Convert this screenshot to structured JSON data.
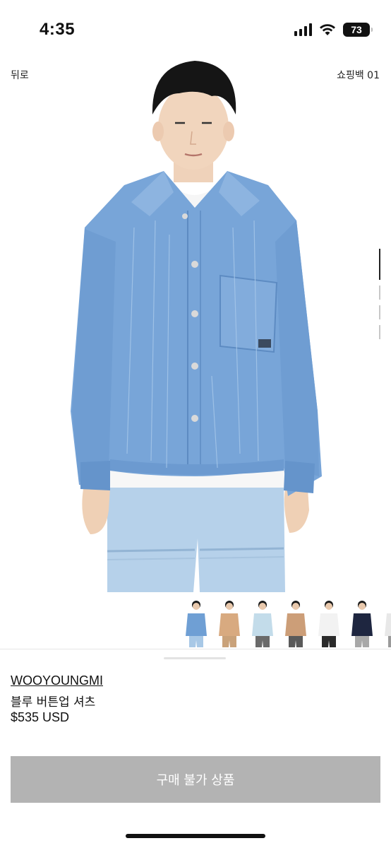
{
  "status": {
    "time": "4:35",
    "battery": "73"
  },
  "nav": {
    "back": "뒤로",
    "bag": "쇼핑백 01"
  },
  "product": {
    "brand": "WOOYOUNGMI",
    "name": "블루 버튼업 셔츠",
    "price": "$535 USD"
  },
  "actions": {
    "buy_label": "구매 불가 상품"
  },
  "pager": {
    "active_index": 0,
    "count": 4
  },
  "thumbnails": [
    {
      "shirt": "#6f9fd4",
      "pants": "#a8c8e6"
    },
    {
      "shirt": "#d8aa80",
      "pants": "#c9a27a"
    },
    {
      "shirt": "#c3dcea",
      "pants": "#6a6a6a"
    },
    {
      "shirt": "#cc9e78",
      "pants": "#5a5a5a"
    },
    {
      "shirt": "#f2f2f2",
      "pants": "#2a2a2a"
    },
    {
      "shirt": "#1e2640",
      "pants": "#a8a8a8"
    },
    {
      "shirt": "#e8e8e8",
      "pants": "#9a9a9a"
    }
  ],
  "colors": {
    "denim": "#7aa6d6",
    "button_disabled": "#b3b3b3"
  }
}
